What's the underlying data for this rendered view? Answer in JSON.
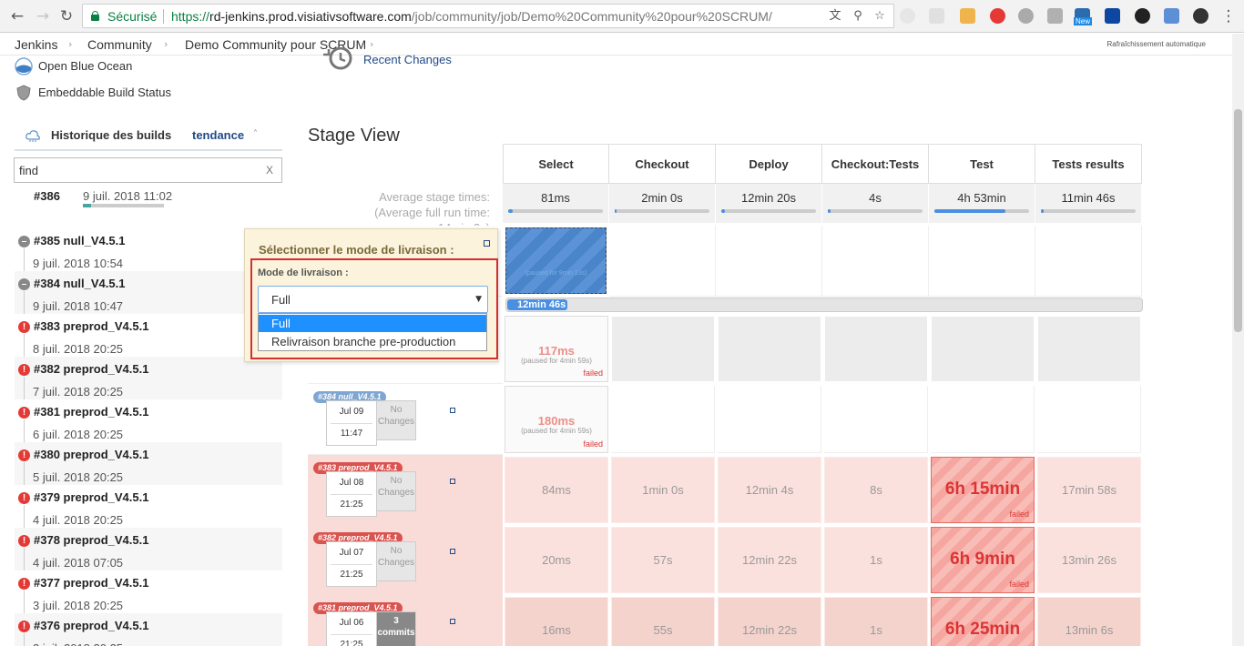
{
  "browser": {
    "secure_label": "Sécurisé",
    "url_scheme": "https://",
    "url_host": "rd-jenkins.prod.visiativsoftware.com",
    "url_path": "/job/community/job/Demo%20Community%20pour%20SCRUM/",
    "ext_new_badge": "New"
  },
  "breadcrumb": {
    "items": [
      "Jenkins",
      "Community",
      "Demo Community pour SCRUM"
    ],
    "auto_refresh": "Rafraîchissement automatique"
  },
  "side": {
    "open_blue_ocean": "Open Blue Ocean",
    "embeddable_status": "Embeddable Build Status",
    "recent_changes": "Recent Changes"
  },
  "build_history": {
    "title": "Historique des builds",
    "trend": "tendance",
    "find_value": "find",
    "find_clear": "X",
    "running": {
      "num": "#386",
      "date": "9 juil. 2018 11:02",
      "progress": 0.1
    },
    "builds": [
      {
        "num": "#385 null_V4.5.1",
        "date": "9 juil. 2018 10:54",
        "status": "aborted"
      },
      {
        "num": "#384 null_V4.5.1",
        "date": "9 juil. 2018 10:47",
        "status": "aborted"
      },
      {
        "num": "#383 preprod_V4.5.1",
        "date": "8 juil. 2018 20:25",
        "status": "failed"
      },
      {
        "num": "#382 preprod_V4.5.1",
        "date": "7 juil. 2018 20:25",
        "status": "failed"
      },
      {
        "num": "#381 preprod_V4.5.1",
        "date": "6 juil. 2018 20:25",
        "status": "failed"
      },
      {
        "num": "#380 preprod_V4.5.1",
        "date": "5 juil. 2018 20:25",
        "status": "failed"
      },
      {
        "num": "#379 preprod_V4.5.1",
        "date": "4 juil. 2018 20:25",
        "status": "failed"
      },
      {
        "num": "#378 preprod_V4.5.1",
        "date": "4 juil. 2018 07:05",
        "status": "failed"
      },
      {
        "num": "#377 preprod_V4.5.1",
        "date": "3 juil. 2018 20:25",
        "status": "failed"
      },
      {
        "num": "#376 preprod_V4.5.1",
        "date": "2 juil. 2018 20:25",
        "status": "failed"
      }
    ]
  },
  "stage_view": {
    "title": "Stage View",
    "avg_label_1": "Average stage times:",
    "avg_label_2": "(Average full run time:",
    "avg_label_3": "~14min 3s)",
    "stages": [
      "Select",
      "Checkout",
      "Deploy",
      "Checkout:Tests",
      "Test",
      "Tests results"
    ],
    "avg_times": [
      "81ms",
      "2min 0s",
      "12min 20s",
      "4s",
      "4h 53min",
      "11min 46s"
    ],
    "avg_fill": [
      0.05,
      0.02,
      0.04,
      0.03,
      0.75,
      0.03
    ],
    "running_caption": "(paused for 9min 13s)",
    "running_progress_label": "12min 46s",
    "runs": [
      {
        "badge": "",
        "date": "",
        "time": "",
        "changes": "",
        "cells": [
          {
            "v": "117ms",
            "paused": "(paused for 4min 59s)",
            "failed": "failed"
          }
        ]
      },
      {
        "badge": "#384 null_V4.5.1",
        "date": "Jul 09",
        "time": "11:47",
        "changes": "No Changes",
        "cells": [
          {
            "v": "180ms",
            "paused": "(paused for 4min 59s)",
            "failed": "failed"
          }
        ]
      },
      {
        "badge": "#383 preprod_V4.5.1",
        "date": "Jul 08",
        "time": "21:25",
        "changes": "No Changes",
        "cells": [
          "84ms",
          "1min 0s",
          "12min 4s",
          "8s",
          "6h 15min",
          "17min 58s"
        ],
        "failed": "failed"
      },
      {
        "badge": "#382 preprod_V4.5.1",
        "date": "Jul 07",
        "time": "21:25",
        "changes": "No Changes",
        "cells": [
          "20ms",
          "57s",
          "12min 22s",
          "1s",
          "6h 9min",
          "13min 26s"
        ],
        "failed": "failed"
      },
      {
        "badge": "#381 preprod_V4.5.1",
        "date": "Jul 06",
        "time": "21:25",
        "changes": "3 commits",
        "cells": [
          "16ms",
          "55s",
          "12min 22s",
          "1s",
          "6h 25min",
          "13min 6s"
        ]
      }
    ]
  },
  "popup": {
    "title": "Sélectionner le mode de livraison :",
    "field_label": "Mode de livraison :",
    "selected": "Full",
    "options": [
      "Full",
      "Relivraison branche pre-production"
    ]
  }
}
